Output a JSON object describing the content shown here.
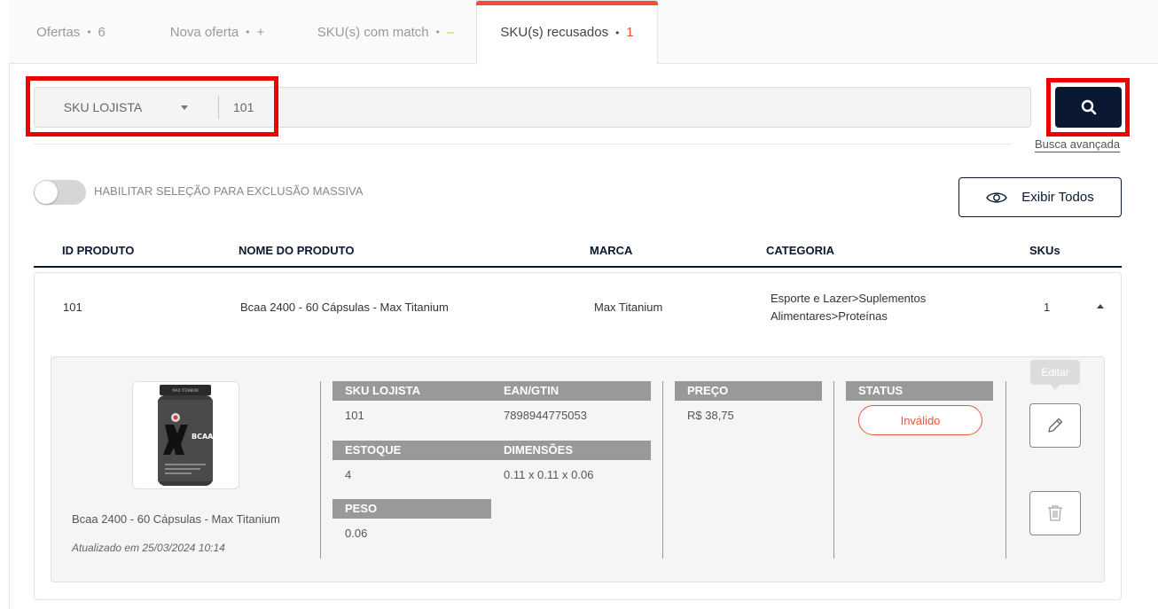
{
  "tabs": [
    {
      "label": "Ofertas",
      "count": "6"
    },
    {
      "label": "Nova oferta",
      "count": "+"
    },
    {
      "label": "SKU(s) com match",
      "count": "–"
    },
    {
      "label": "SKU(s) recusados",
      "count": "1"
    }
  ],
  "search": {
    "field": "SKU LOJISTA",
    "value": "101",
    "advanced_link": "Busca avançada"
  },
  "toolbar": {
    "bulk_toggle_label": "HABILITAR SELEÇÃO PARA EXCLUSÃO MASSIVA",
    "bulk_toggle_on": false,
    "show_all_label": "Exibir Todos"
  },
  "table": {
    "headers": [
      "ID PRODUTO",
      "NOME DO PRODUTO",
      "MARCA",
      "CATEGORIA",
      "SKUs"
    ],
    "row": {
      "id": "101",
      "name": "Bcaa 2400 - 60 Cápsulas - Max Titanium",
      "brand": "Max Titanium",
      "category_line1": "Esporte e Lazer>Suplementos",
      "category_line2": "Alimentares>Proteínas",
      "skus": "1"
    }
  },
  "detail": {
    "product_name": "Bcaa 2400 - 60 Cápsulas - Max Titanium",
    "updated": "Atualizado em 25/03/2024 10:14",
    "image_brand": "MAX TITANIUM",
    "image_label": "BCAA 2400",
    "labels": {
      "sku": "SKU LOJISTA",
      "ean": "EAN/GTIN",
      "stock": "ESTOQUE",
      "dimensions": "DIMENSÕES",
      "weight": "PESO",
      "price": "PREÇO",
      "status": "STATUS"
    },
    "values": {
      "sku": "101",
      "ean": "7898944775053",
      "stock": "4",
      "dimensions": "0.11 x 0.11 x 0.06",
      "weight": "0.06",
      "price": "R$ 38,75",
      "status": "Inválido"
    },
    "edit_tooltip": "Editar"
  },
  "colors": {
    "accent": "#f04e37",
    "navy": "#0a1931",
    "highlight": "#ee0000",
    "label_bg": "#999999"
  },
  "icons": [
    "search-icon",
    "eye-icon",
    "caret-down-icon",
    "caret-up-icon",
    "pencil-icon",
    "trash-icon"
  ]
}
